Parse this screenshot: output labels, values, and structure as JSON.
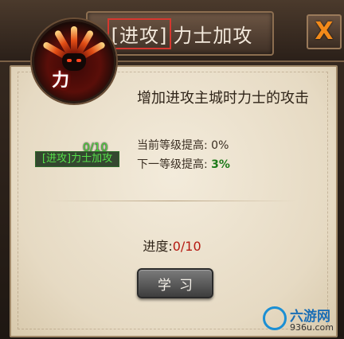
{
  "title": {
    "bracket_part": "[进攻]",
    "rest_part": "力士加攻"
  },
  "close_label": "X",
  "skill": {
    "icon_name": "warrior-helmet-flame-icon",
    "glyph": "力",
    "level": "0/10",
    "label": "[进攻]力士加攻"
  },
  "description": "增加进攻主城时力士的攻击",
  "stats": {
    "current_label": "当前等级提高: ",
    "current_value": "0%",
    "next_label": "下一等级提高: ",
    "next_value": "3%"
  },
  "progress": {
    "label": "进度:",
    "value": "0/10"
  },
  "learn_button": "学习",
  "watermark": {
    "name": "六游网",
    "url": "936u.com"
  },
  "colors": {
    "accent_close": "#f28a1a",
    "progress_value": "#b51b12",
    "next_value": "#1d7a1a",
    "level_green": "#4fdc3f"
  }
}
